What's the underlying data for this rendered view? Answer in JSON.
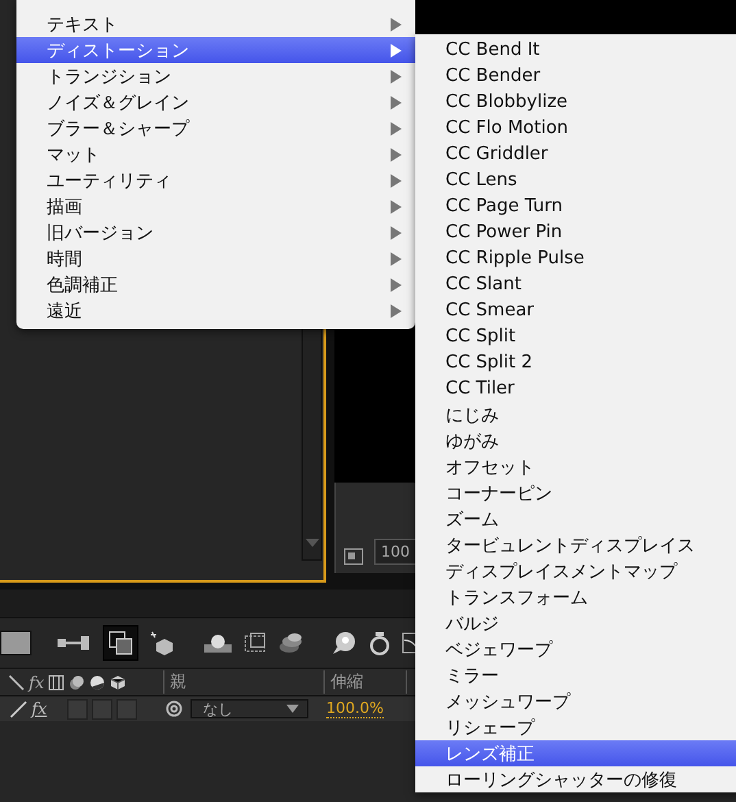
{
  "effect_menu": [
    {
      "label": "テキスト",
      "selected": false
    },
    {
      "label": "ディストーション",
      "selected": true
    },
    {
      "label": "トランジション",
      "selected": false
    },
    {
      "label": "ノイズ＆グレイン",
      "selected": false
    },
    {
      "label": "ブラー＆シャープ",
      "selected": false
    },
    {
      "label": "マット",
      "selected": false
    },
    {
      "label": "ユーティリティ",
      "selected": false
    },
    {
      "label": "描画",
      "selected": false
    },
    {
      "label": "旧バージョン",
      "selected": false
    },
    {
      "label": "時間",
      "selected": false
    },
    {
      "label": "色調補正",
      "selected": false
    },
    {
      "label": "遠近",
      "selected": false
    }
  ],
  "distortion_submenu": [
    {
      "label": "CC Bend It",
      "selected": false
    },
    {
      "label": "CC Bender",
      "selected": false
    },
    {
      "label": "CC Blobbylize",
      "selected": false
    },
    {
      "label": "CC Flo Motion",
      "selected": false
    },
    {
      "label": "CC Griddler",
      "selected": false
    },
    {
      "label": "CC Lens",
      "selected": false
    },
    {
      "label": "CC Page Turn",
      "selected": false
    },
    {
      "label": "CC Power Pin",
      "selected": false
    },
    {
      "label": "CC Ripple Pulse",
      "selected": false
    },
    {
      "label": "CC Slant",
      "selected": false
    },
    {
      "label": "CC Smear",
      "selected": false
    },
    {
      "label": "CC Split",
      "selected": false
    },
    {
      "label": "CC Split 2",
      "selected": false
    },
    {
      "label": "CC Tiler",
      "selected": false
    },
    {
      "label": "にじみ",
      "selected": false
    },
    {
      "label": "ゆがみ",
      "selected": false
    },
    {
      "label": "オフセット",
      "selected": false
    },
    {
      "label": "コーナーピン",
      "selected": false
    },
    {
      "label": "ズーム",
      "selected": false
    },
    {
      "label": "タービュレントディスプレイス",
      "selected": false
    },
    {
      "label": "ディスプレイスメントマップ",
      "selected": false
    },
    {
      "label": "トランスフォーム",
      "selected": false
    },
    {
      "label": "バルジ",
      "selected": false
    },
    {
      "label": "ベジェワープ",
      "selected": false
    },
    {
      "label": "ミラー",
      "selected": false
    },
    {
      "label": "メッシュワープ",
      "selected": false
    },
    {
      "label": "リシェープ",
      "selected": false
    },
    {
      "label": "レンズ補正",
      "selected": true
    },
    {
      "label": "ローリングシャッターの修復",
      "selected": false
    }
  ],
  "viewer": {
    "zoom": "100"
  },
  "timeline": {
    "header_fx": "fx",
    "parent_header": "親",
    "stretch_header": "伸縮",
    "layer_fx": "fx",
    "fx_on": true,
    "layer_switches": [
      {
        "checked": false
      },
      {
        "checked": false
      },
      {
        "checked": false
      }
    ],
    "parent_value": "なし",
    "stretch_value": "100.0%"
  }
}
